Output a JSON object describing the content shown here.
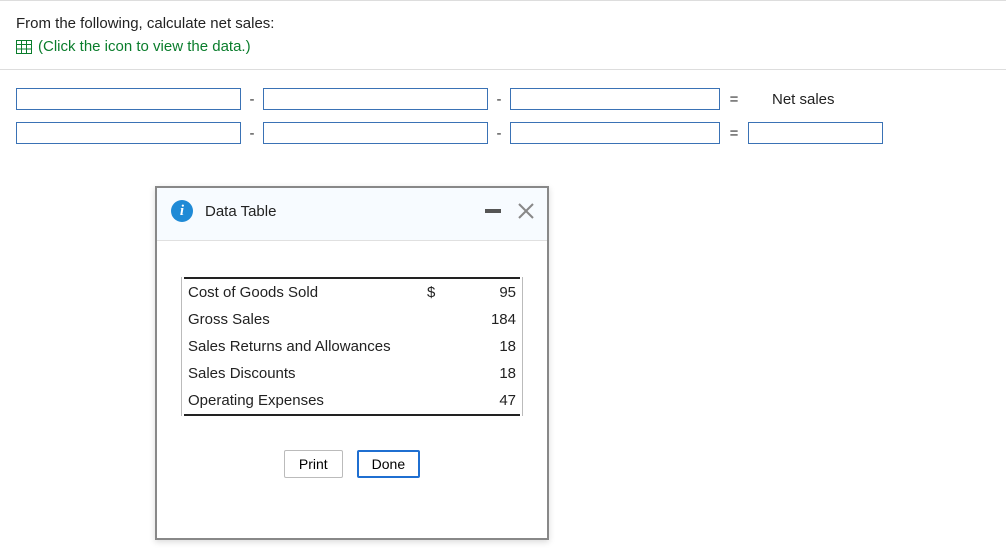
{
  "question": {
    "line1": "From the following, calculate net sales:",
    "hint": "(Click the icon to view the data.)"
  },
  "worksheet": {
    "minus": "-",
    "equals": "=",
    "result_label": "Net sales"
  },
  "dialog": {
    "title": "Data Table",
    "info_glyph": "i",
    "rows": [
      {
        "label": "Cost of Goods Sold",
        "symbol": "$",
        "value": "95"
      },
      {
        "label": "Gross Sales",
        "symbol": "",
        "value": "184"
      },
      {
        "label": "Sales Returns and Allowances",
        "symbol": "",
        "value": "18"
      },
      {
        "label": "Sales Discounts",
        "symbol": "",
        "value": "18"
      },
      {
        "label": "Operating Expenses",
        "symbol": "",
        "value": "47"
      }
    ],
    "buttons": {
      "print": "Print",
      "done": "Done"
    }
  }
}
